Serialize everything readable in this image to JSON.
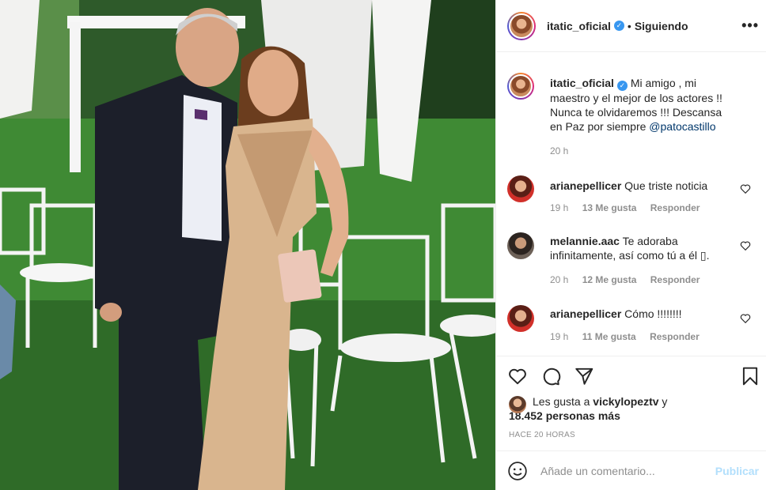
{
  "header": {
    "username": "itatic_oficial",
    "separator": "•",
    "follow_label": "Siguiendo",
    "more_label": "•••"
  },
  "caption": {
    "username": "itatic_oficial",
    "text": "Mi amigo , mi maestro y el mejor de los actores !! Nunca te olvidaremos !!! Descansa en Paz por siempre ",
    "mention": "@patocastillo",
    "time": "20 h"
  },
  "comments": [
    {
      "username": "arianepellicer",
      "text": "Que triste noticia",
      "time": "19 h",
      "likes": "13 Me gusta",
      "reply": "Responder"
    },
    {
      "username": "melannie.aac",
      "text": "Te adoraba infinitamente, así como tú a él ▯.",
      "time": "20 h",
      "likes": "12 Me gusta",
      "reply": "Responder"
    },
    {
      "username": "arianepellicer",
      "text": "Cómo !!!!!!!!",
      "time": "19 h",
      "likes": "11 Me gusta",
      "reply": "Responder"
    }
  ],
  "likes": {
    "prefix": "Les gusta a ",
    "user": "vickylopeztv",
    "middle": " y",
    "others": "18.452 personas más"
  },
  "timestamp": "HACE 20 HORAS",
  "composer": {
    "placeholder": "Añade un comentario...",
    "post_label": "Publicar"
  },
  "icons": {
    "like": "heart-icon",
    "comment": "comment-icon",
    "share": "share-icon",
    "save": "bookmark-icon",
    "emoji": "emoji-icon",
    "verified": "verified-badge-icon"
  },
  "colors": {
    "verified": "#3897f0",
    "mention": "#00376b",
    "muted": "#8e8e8e",
    "post_disabled": "#b2dffc"
  }
}
